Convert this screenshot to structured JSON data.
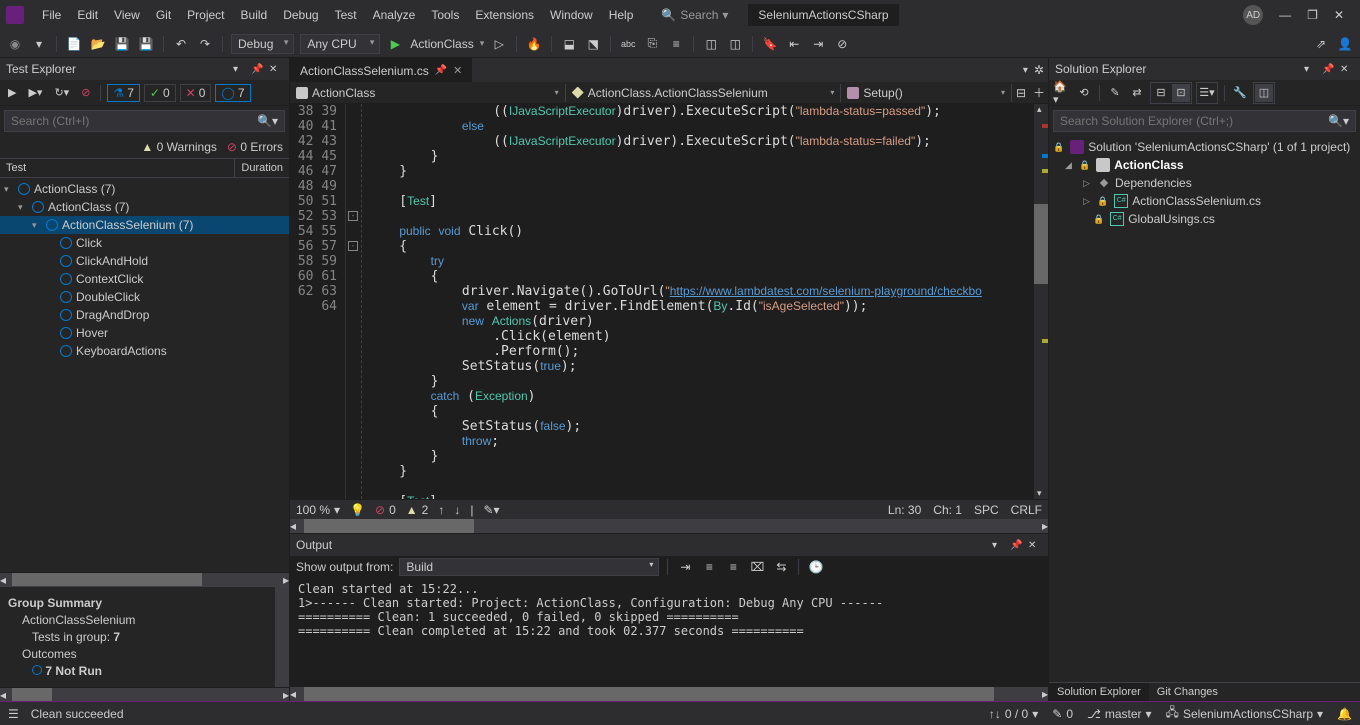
{
  "menu": [
    "File",
    "Edit",
    "View",
    "Git",
    "Project",
    "Build",
    "Debug",
    "Test",
    "Analyze",
    "Tools",
    "Extensions",
    "Window",
    "Help"
  ],
  "search_label": "Search",
  "solution_title": "SeleniumActionsCSharp",
  "avatar": "AD",
  "toolbar": {
    "config": "Debug",
    "platform": "Any CPU",
    "start": "ActionClass"
  },
  "testExplorer": {
    "title": "Test Explorer",
    "search_placeholder": "Search (Ctrl+I)",
    "pills": [
      [
        "▹",
        "",
        "play"
      ],
      [
        "▹",
        "",
        "play-all"
      ],
      [
        "↻",
        "",
        "repeat"
      ],
      [
        "⊘",
        "",
        "cancel"
      ]
    ],
    "counts": {
      "flask": "7",
      "pass": "0",
      "fail": "0",
      "notrun": "7"
    },
    "warnings": "0 Warnings",
    "errors": "0 Errors",
    "col_test": "Test",
    "col_dur": "Duration",
    "tree": [
      {
        "lvl": 0,
        "exp": "▾",
        "label": "ActionClass  (7)"
      },
      {
        "lvl": 1,
        "exp": "▾",
        "label": "ActionClass  (7)"
      },
      {
        "lvl": 2,
        "exp": "▾",
        "label": "ActionClassSelenium  (7)",
        "sel": true
      },
      {
        "lvl": 3,
        "label": "Click"
      },
      {
        "lvl": 3,
        "label": "ClickAndHold"
      },
      {
        "lvl": 3,
        "label": "ContextClick"
      },
      {
        "lvl": 3,
        "label": "DoubleClick"
      },
      {
        "lvl": 3,
        "label": "DragAndDrop"
      },
      {
        "lvl": 3,
        "label": "Hover"
      },
      {
        "lvl": 3,
        "label": "KeyboardActions"
      }
    ],
    "summary": {
      "title": "Group Summary",
      "name": "ActionClassSelenium",
      "tests_label": "Tests in group:",
      "tests": "7",
      "outcomes": "Outcomes",
      "outcome1": "7 Not  Run"
    }
  },
  "editor": {
    "tab": "ActionClassSelenium.cs",
    "nav1": "ActionClass",
    "nav2": "ActionClass.ActionClassSelenium",
    "nav3": "Setup()",
    "first_line": 38,
    "lines": [
      "                ((<t>IJavaScriptExecutor</t>)driver).ExecuteScript(<s>\"lambda-status=passed\"</s>);",
      "            <k>else</k>",
      "                ((<t>IJavaScriptExecutor</t>)driver).ExecuteScript(<s>\"lambda-status=failed\"</s>);",
      "        }",
      "    }",
      "",
      "    [<t>Test</t>]",
      "",
      "    <k>public</k> <k>void</k> Click()",
      "    {",
      "        <k>try</k>",
      "        {",
      "            driver.Navigate().GoToUrl(<s>\"</s><l>https://www.lambdatest.com/selenium-playground/checkbo</l>",
      "            <k>var</k> element = driver.FindElement(<t>By</t>.Id(<s>\"isAgeSelected\"</s>));",
      "            <k>new</k> <t>Actions</t>(driver)",
      "                .Click(element)",
      "                .Perform();",
      "            SetStatus(<k>true</k>);",
      "        }",
      "        <k>catch</k> (<t>Exception</t>)",
      "        {",
      "            SetStatus(<k>false</k>);",
      "            <k>throw</k>;",
      "        }",
      "    }",
      "",
      "    [<t>Test</t>]"
    ],
    "status": {
      "zoom": "100 %",
      "err": "0",
      "warn": "2",
      "ln": "Ln: 30",
      "ch": "Ch: 1",
      "spc": "SPC",
      "crlf": "CRLF"
    }
  },
  "output": {
    "title": "Output",
    "from_label": "Show output from:",
    "from": "Build",
    "text": "Clean started at 15:22...\n1>------ Clean started: Project: ActionClass, Configuration: Debug Any CPU ------\n========== Clean: 1 succeeded, 0 failed, 0 skipped ==========\n========== Clean completed at 15:22 and took 02.377 seconds =========="
  },
  "solutionExplorer": {
    "title": "Solution Explorer",
    "search_placeholder": "Search Solution Explorer (Ctrl+;)",
    "solution": "Solution 'SeleniumActionsCSharp' (1 of 1 project)",
    "project": "ActionClass",
    "deps": "Dependencies",
    "file1": "ActionClassSelenium.cs",
    "file2": "GlobalUsings.cs",
    "bottom": [
      "Solution Explorer",
      "Git Changes"
    ]
  },
  "statusbar": {
    "msg": "Clean succeeded",
    "updown": "0 / 0",
    "pen": "0",
    "branch": "master",
    "repo": "SeleniumActionsCSharp"
  }
}
